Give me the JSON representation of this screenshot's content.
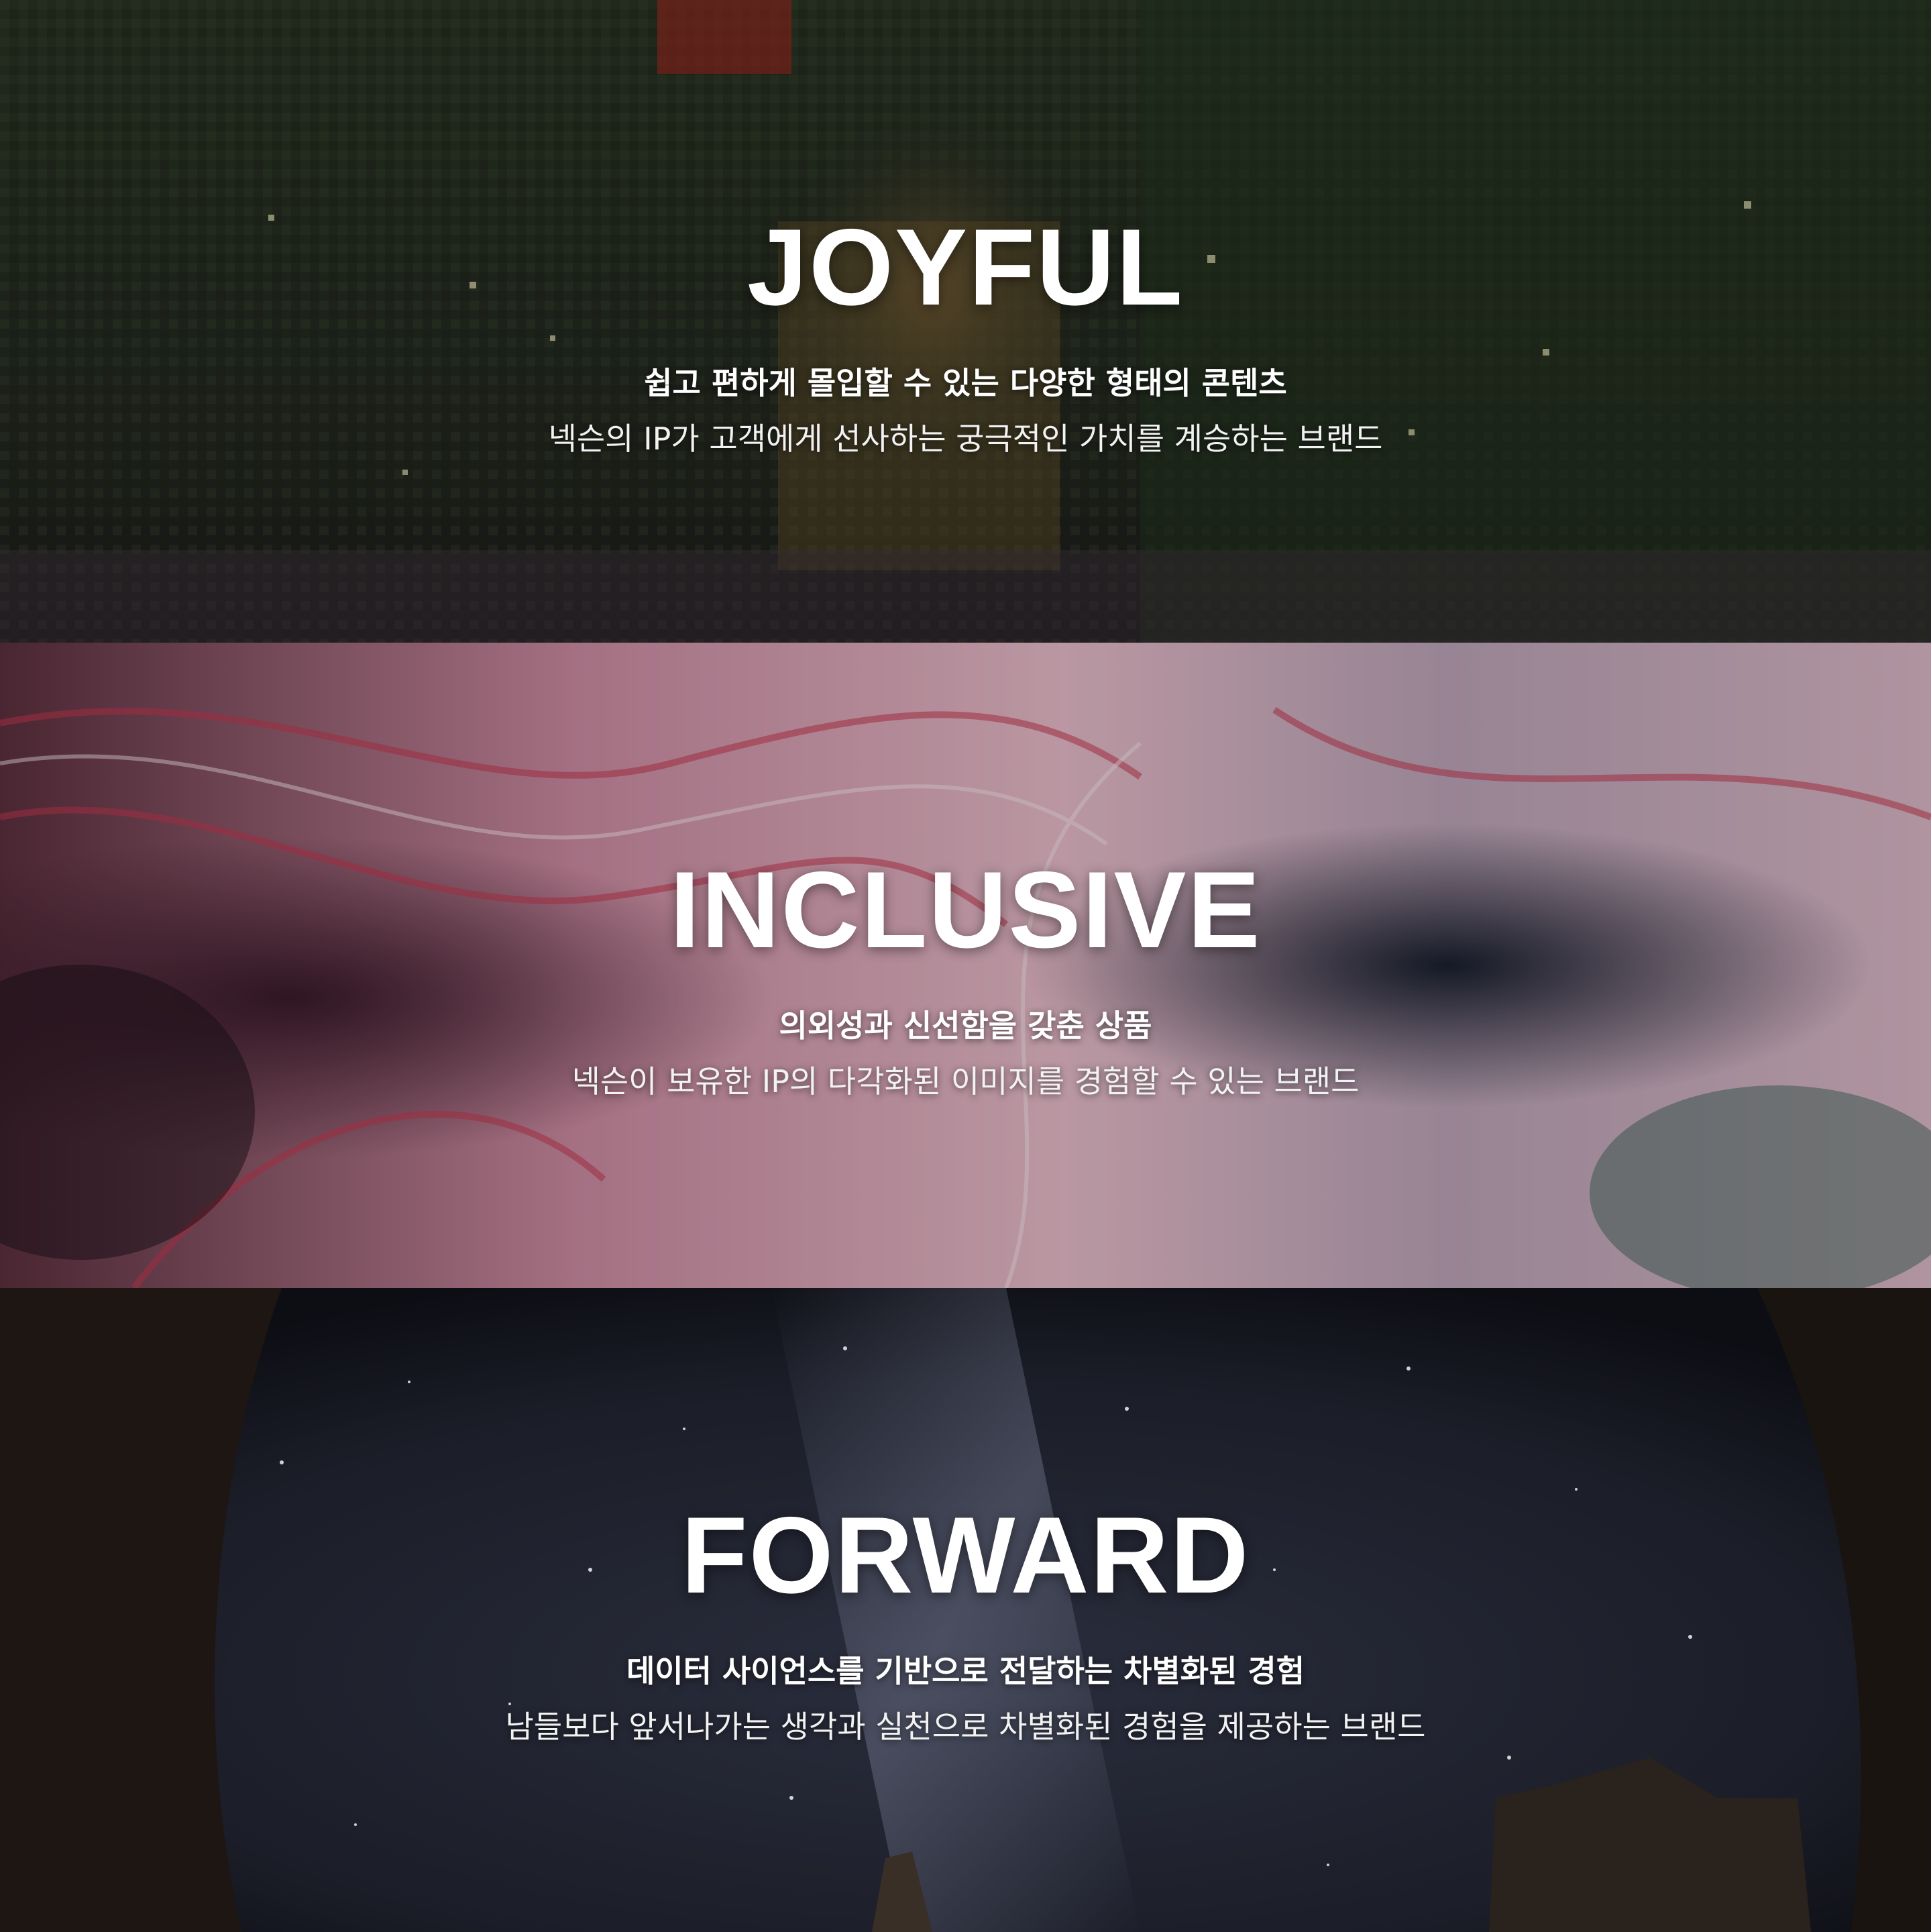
{
  "sections": [
    {
      "title": "JOYFUL",
      "line1": "쉽고 편하게 몰입할 수 있는 다양한 형태의 콘텐츠",
      "line2": "넥슨의 IP가 고객에게 선사하는 궁극적인 가치를 계승하는 브랜드",
      "background": "pixelated-mosaic-photo",
      "colors": {
        "base": "#2c3326",
        "accent": "#d9a441",
        "highlight": "#c8382b"
      }
    },
    {
      "title": "INCLUSIVE",
      "line1": "의외성과 신선함을 갖춘 상품",
      "line2": "넥슨이 보유한 IP의 다각화된 이미지를 경험할 수 있는 브랜드",
      "background": "marbled-paint-swirl",
      "colors": {
        "base": "#b98a9b",
        "accent": "#c2374f",
        "highlight": "#2f5a4e"
      }
    },
    {
      "title": "FORWARD",
      "line1": "데이터 사이언스를 기반으로 전달하는 차별화된 경험",
      "line2": "남들보다 앞서나가는 생각과 실천으로 차별화된 경험을 제공하는 브랜드",
      "background": "starry-night-sky",
      "colors": {
        "base": "#1c1f2b",
        "accent": "#8a8fa8",
        "highlight": "#3a2f26"
      }
    }
  ]
}
